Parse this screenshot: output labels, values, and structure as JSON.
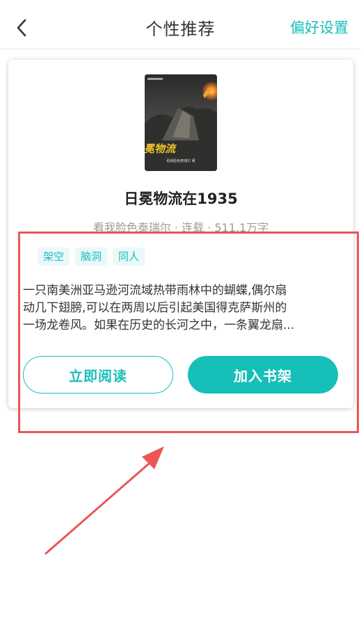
{
  "header": {
    "title": "个性推荐",
    "action_label": "偏好设置",
    "back_icon": "chevron-left-icon"
  },
  "book": {
    "cover_text": "日冕物流",
    "cover_subtext": "看我脸色泰瑞尔 著",
    "title": "日冕物流在1935",
    "author": "看我脸色泰瑞尔",
    "status": "连载",
    "word_count": "511.1万字",
    "separator": " · ",
    "tags": [
      "架空",
      "脑洞",
      "同人"
    ],
    "description_lines": [
      "一只南美洲亚马逊河流域热带雨林中的蝴蝶,偶尔扇",
      "动几下翅膀,可以在两周以后引起美国得克萨斯州的",
      "一场龙卷风。如果在历史的长河之中，一条翼龙扇..."
    ]
  },
  "actions": {
    "read_label": "立即阅读",
    "add_shelf_label": "加入书架"
  },
  "colors": {
    "accent": "#17bfb9",
    "annotation": "#ec5456",
    "title_text": "#222222",
    "meta_text": "#9c9c9c"
  }
}
